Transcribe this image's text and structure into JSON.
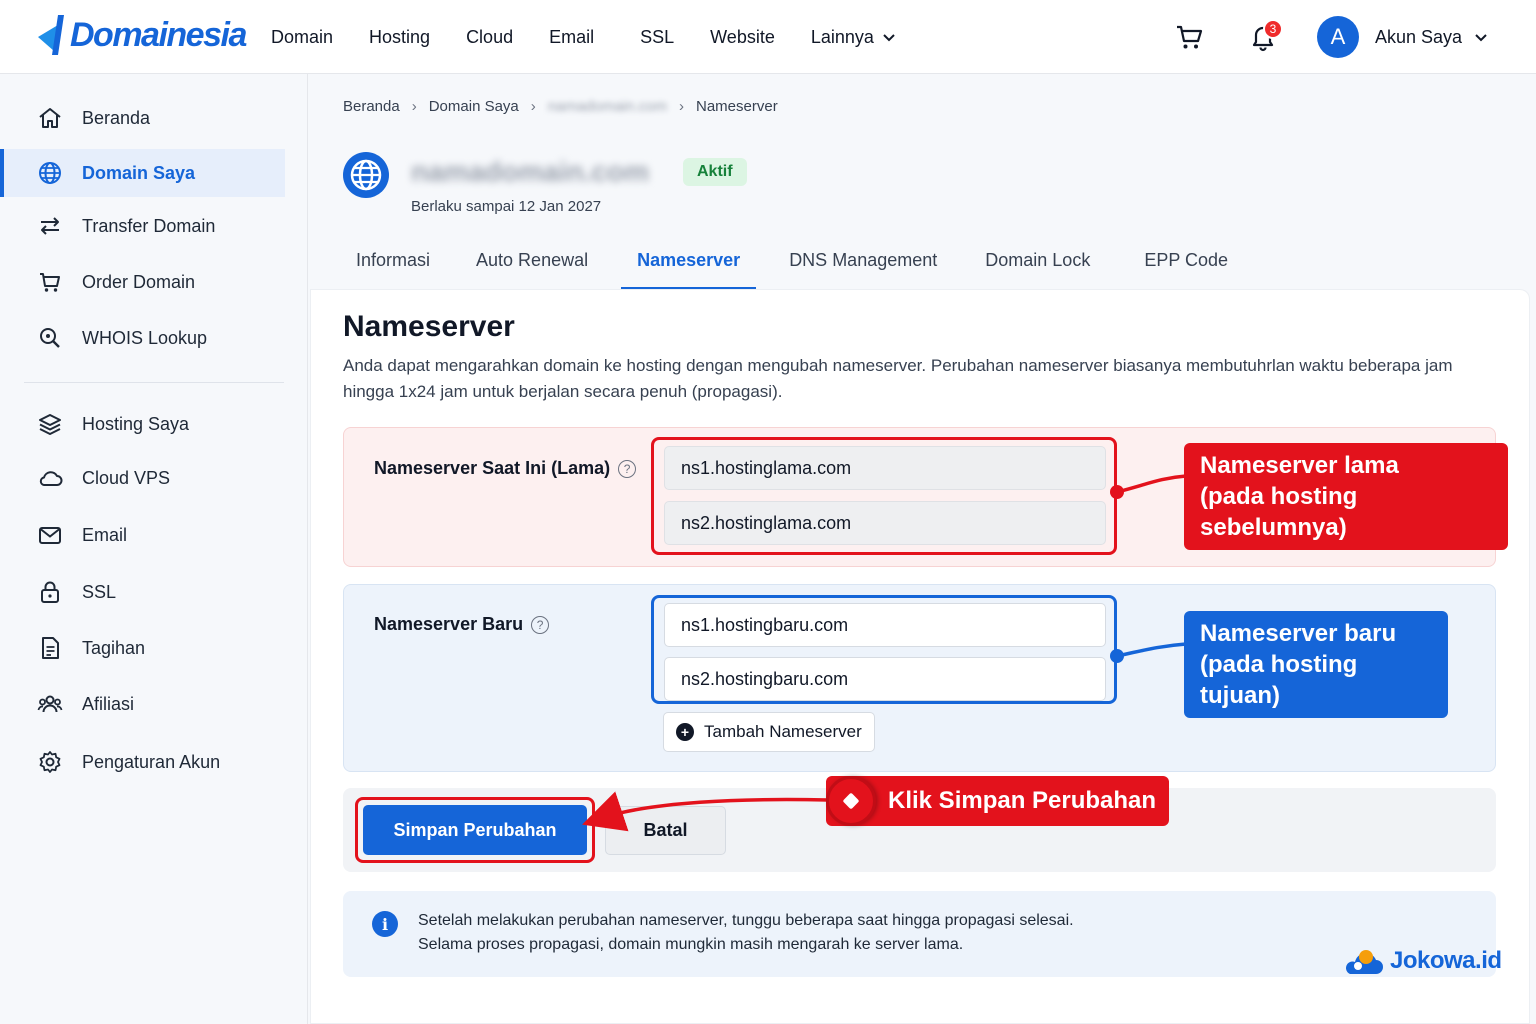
{
  "brand": {
    "logo_text": "Domainesia",
    "accent": "#1565d8",
    "danger": "#e3121c",
    "success": "#16813a"
  },
  "nav": {
    "items": [
      "Domain",
      "Hosting",
      "Cloud",
      "Email",
      "SSL",
      "Website"
    ],
    "more_label": "Lainnya",
    "cart_icon": "cart-icon",
    "notification_icon": "bell-icon",
    "notification_count": "3",
    "avatar_initial": "A",
    "account_label": "Akun Saya"
  },
  "sidebar": {
    "items": [
      {
        "label": "Beranda",
        "icon": "home-icon"
      },
      {
        "label": "Domain Saya",
        "icon": "globe-icon",
        "active": true
      },
      {
        "label": "Transfer Domain",
        "icon": "transfer-icon"
      },
      {
        "label": "Order Domain",
        "icon": "cart-icon"
      },
      {
        "label": "WHOIS Lookup",
        "icon": "search-icon"
      },
      {
        "label": "Hosting Saya",
        "icon": "layers-icon"
      },
      {
        "label": "Cloud VPS",
        "icon": "cloud-icon"
      },
      {
        "label": "Email",
        "icon": "mail-icon"
      },
      {
        "label": "SSL",
        "icon": "lock-icon"
      },
      {
        "label": "Tagihan",
        "icon": "invoice-icon"
      },
      {
        "label": "Afiliasi",
        "icon": "users-icon"
      },
      {
        "label": "Pengaturan Akun",
        "icon": "gear-icon"
      }
    ]
  },
  "breadcrumb": [
    "Beranda",
    "Domain Saya",
    "namadomain.com",
    "Nameserver"
  ],
  "domain": {
    "name": "namadomain.com",
    "status": "Aktif",
    "expiry": "Berlaku sampai 12 Jan 2027"
  },
  "tabs": [
    "Informasi",
    "Auto Renewal",
    "Nameserver",
    "DNS Management",
    "Domain Lock",
    "EPP Code"
  ],
  "active_tab": "Nameserver",
  "section": {
    "title": "Nameserver",
    "description": "Anda dapat mengarahkan domain ke hosting dengan mengubah nameserver. Perubahan nameserver biasanya membutuhrlan waktu beberapa jam hingga 1x24 jam untuk berjalan secara penuh (propagasi)."
  },
  "ns_old": {
    "label": "Nameserver Saat Ini (Lama)",
    "values": [
      "ns1.hostinglama.com",
      "ns2.hostinglama.com"
    ]
  },
  "ns_new": {
    "label": "Nameserver Baru",
    "values": [
      "ns1.hostingbaru.com",
      "ns2.hostingbaru.com"
    ],
    "add_label": "Tambah Nameserver"
  },
  "actions": {
    "save_label": "Simpan Perubahan",
    "cancel_label": "Batal"
  },
  "callouts": {
    "old_line1": "Nameserver lama",
    "old_line2": "(pada hosting sebelumnya)",
    "new_line1": "Nameserver baru",
    "new_line2": "(pada hosting tujuan)",
    "click": "Klik Simpan Perubahan"
  },
  "info": {
    "line1": "Setelah melakukan perubahan nameserver, tunggu beberapa saat hingga propagasi selesai.",
    "line2": "Selama proses propagasi, domain mungkin masih mengarah ke server lama."
  },
  "watermark": "Jokowa.id"
}
